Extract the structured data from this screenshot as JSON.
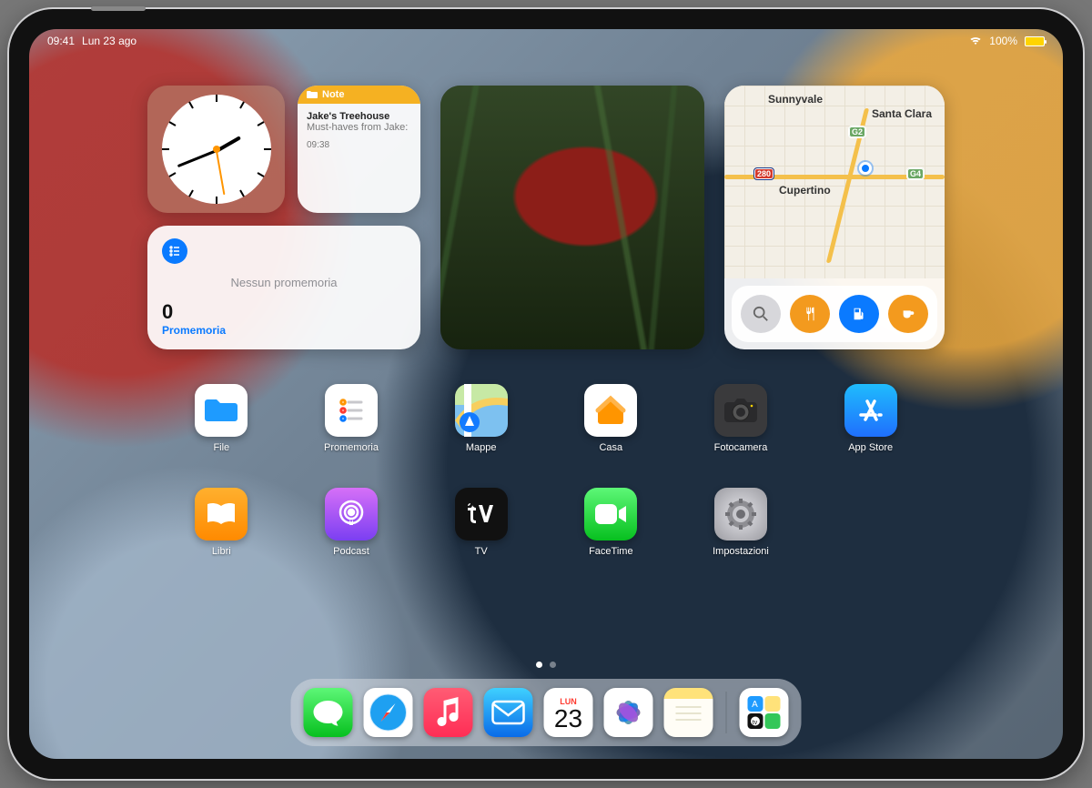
{
  "status": {
    "time": "09:41",
    "date": "Lun 23 ago",
    "battery": "100%"
  },
  "widgets": {
    "notes": {
      "header": "Note",
      "title": "Jake's Treehouse",
      "subtitle": "Must-haves from Jake:",
      "timestamp": "09:38"
    },
    "reminders": {
      "empty_text": "Nessun promemoria",
      "count": "0",
      "label": "Promemoria"
    },
    "maps": {
      "labels": {
        "sunnyvale": "Sunnyvale",
        "santa_clara": "Santa Clara",
        "cupertino": "Cupertino"
      },
      "shields": {
        "i280": "280",
        "g2": "G2",
        "g4": "G4"
      }
    }
  },
  "apps": {
    "row1": [
      {
        "id": "file",
        "label": "File"
      },
      {
        "id": "promemoria",
        "label": "Promemoria"
      },
      {
        "id": "mappe",
        "label": "Mappe"
      },
      {
        "id": "casa",
        "label": "Casa"
      },
      {
        "id": "fotocamera",
        "label": "Fotocamera"
      },
      {
        "id": "appstore",
        "label": "App Store"
      }
    ],
    "row2": [
      {
        "id": "libri",
        "label": "Libri"
      },
      {
        "id": "podcast",
        "label": "Podcast"
      },
      {
        "id": "tv",
        "label": "TV"
      },
      {
        "id": "facetime",
        "label": "FaceTime"
      },
      {
        "id": "impostazioni",
        "label": "Impostazioni"
      }
    ]
  },
  "dock": {
    "calendar": {
      "weekday": "LUN",
      "day": "23"
    }
  }
}
